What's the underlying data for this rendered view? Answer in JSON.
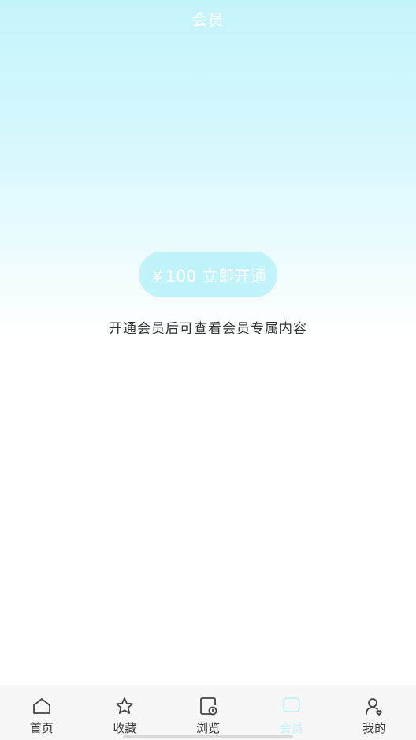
{
  "header": {
    "title": "会员"
  },
  "membership": {
    "buy_button_label": "￥100 立即开通",
    "hint": "开通会员后可查看会员专属内容"
  },
  "tabbar": {
    "items": [
      {
        "label": "首页",
        "icon": "home-icon"
      },
      {
        "label": "收藏",
        "icon": "star-icon"
      },
      {
        "label": "浏览",
        "icon": "history-icon"
      },
      {
        "label": "会员",
        "icon": "member-icon",
        "active": true
      },
      {
        "label": "我的",
        "icon": "profile-icon"
      }
    ]
  },
  "colors": {
    "accent": "#c2f2fa",
    "gradient_top": "#c4f4fb",
    "text": "#333333"
  }
}
